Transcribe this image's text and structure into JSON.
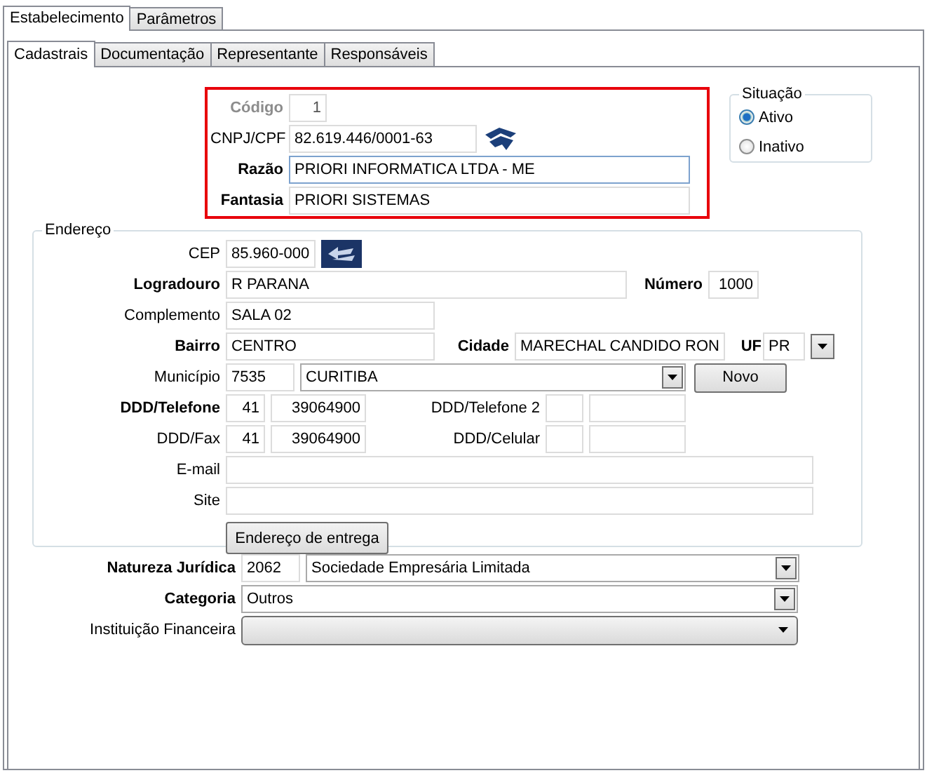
{
  "outer_tabs": [
    {
      "label": "Estabelecimento",
      "selected": true
    },
    {
      "label": "Parâmetros",
      "selected": false
    }
  ],
  "inner_tabs": [
    {
      "label": "Cadastrais",
      "selected": true
    },
    {
      "label": "Documentação",
      "selected": false
    },
    {
      "label": "Representante",
      "selected": false
    },
    {
      "label": "Responsáveis",
      "selected": false
    }
  ],
  "identification": {
    "codigo": {
      "label": "Código",
      "value": "1",
      "disabled": true
    },
    "cnpj": {
      "label": "CNPJ/CPF",
      "value": "82.619.446/0001-63",
      "required": false
    },
    "razao": {
      "label": "Razão",
      "value": "PRIORI INFORMATICA LTDA - ME",
      "required": true
    },
    "fantasia": {
      "label": "Fantasia",
      "value": "PRIORI SISTEMAS",
      "required": true
    }
  },
  "situacao": {
    "title": "Situação",
    "options": [
      {
        "label": "Ativo",
        "selected": true
      },
      {
        "label": "Inativo",
        "selected": false
      }
    ]
  },
  "endereco": {
    "title": "Endereço",
    "cep": {
      "label": "CEP",
      "value": "85.960-000",
      "required": false
    },
    "logradouro": {
      "label": "Logradouro",
      "value": "R PARANA",
      "required": true
    },
    "numero": {
      "label": "Número",
      "value": "1000",
      "required": true
    },
    "complemento": {
      "label": "Complemento",
      "value": "SALA 02",
      "required": false
    },
    "bairro": {
      "label": "Bairro",
      "value": "CENTRO",
      "required": true
    },
    "cidade": {
      "label": "Cidade",
      "value": "MARECHAL CANDIDO RON",
      "required": true
    },
    "uf": {
      "label": "UF",
      "value": "PR",
      "required": true
    },
    "municipio": {
      "label": "Município",
      "code": "7535",
      "value": "CURITIBA",
      "required": false
    },
    "novo_button": "Novo",
    "telefone": {
      "label": "DDD/Telefone",
      "ddd": "41",
      "number": "39064900",
      "required": true
    },
    "telefone2": {
      "label": "DDD/Telefone 2",
      "required": false
    },
    "fax": {
      "label": "DDD/Fax",
      "ddd": "41",
      "number": "39064900",
      "required": false
    },
    "celular": {
      "label": "DDD/Celular",
      "required": false
    },
    "email": {
      "label": "E-mail",
      "required": false
    },
    "site": {
      "label": "Site",
      "required": false
    },
    "delivery_button": "Endereço de entrega"
  },
  "natureza": {
    "label": "Natureza Jurídica",
    "code": "2062",
    "value": "Sociedade Empresária Limitada",
    "required": true
  },
  "categoria": {
    "label": "Categoria",
    "value": "Outros",
    "required": true
  },
  "instituicao": {
    "label": "Instituição Financeira",
    "required": false
  }
}
